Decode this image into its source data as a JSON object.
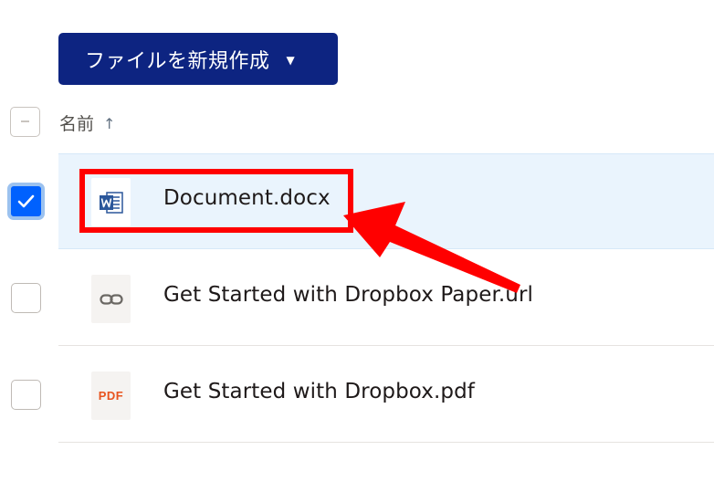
{
  "toolbar": {
    "new_file_label": "ファイルを新規作成",
    "new_file_caret": "▼"
  },
  "table": {
    "header": {
      "name_label": "名前",
      "sort_arrow": "↑"
    },
    "rows": [
      {
        "name": "Document.docx",
        "icon": "word-file-icon",
        "selected": true
      },
      {
        "name": "Get Started with Dropbox Paper.url",
        "icon": "link-icon",
        "selected": false
      },
      {
        "name": "Get Started with Dropbox.pdf",
        "icon": "pdf-file-icon",
        "icon_text": "PDF",
        "selected": false
      }
    ]
  },
  "colors": {
    "button_bg": "#0d2481",
    "selected_row_bg": "#eaf4fd",
    "checkbox_checked": "#0061fe",
    "annotation": "#ff0000",
    "pdf_red": "#e8541f",
    "word_blue": "#2b579a"
  }
}
